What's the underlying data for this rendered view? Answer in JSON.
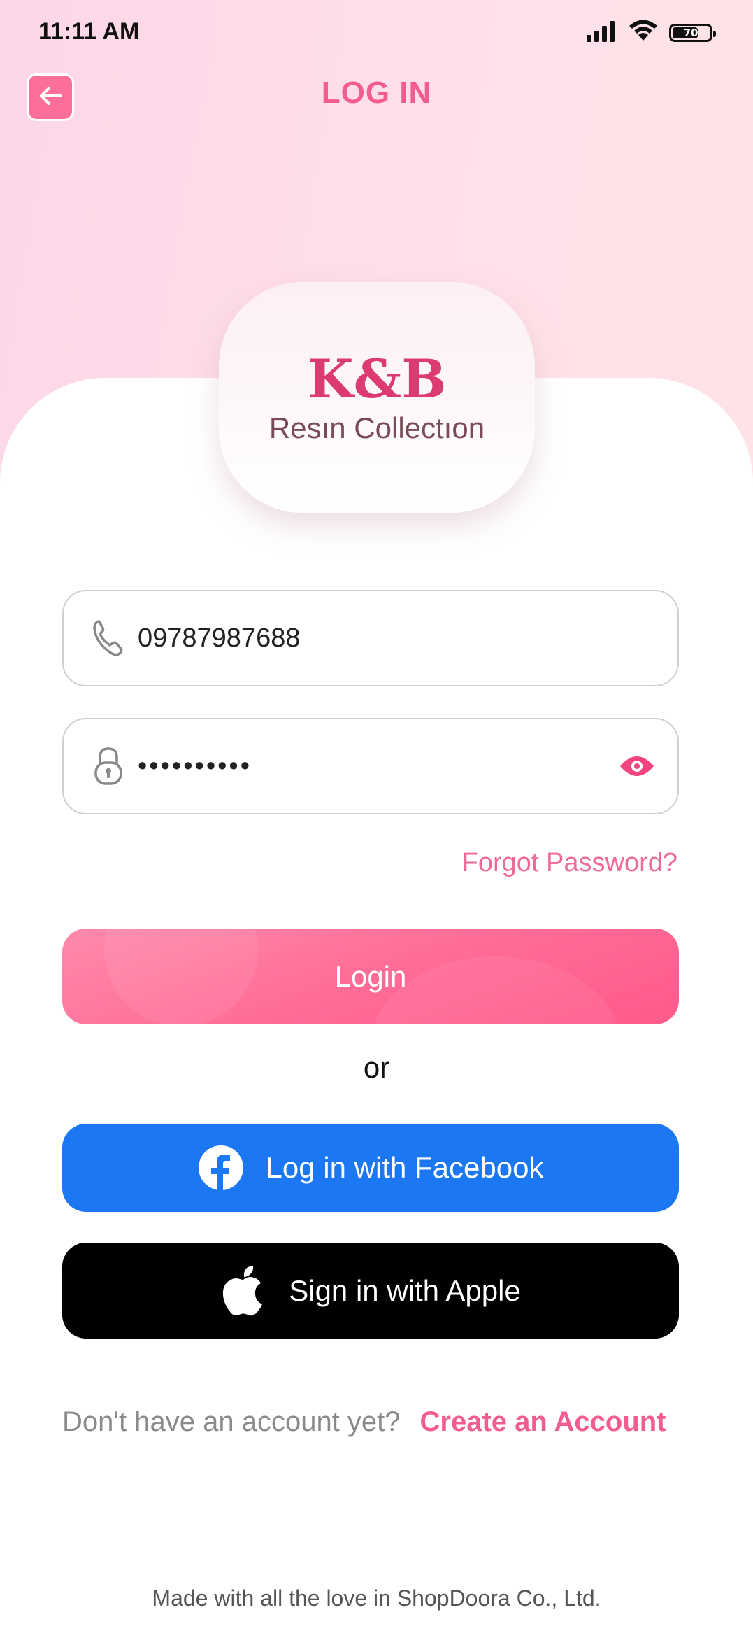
{
  "status_bar": {
    "time": "11:11 AM",
    "battery_level": "70",
    "battery_fraction": 0.7,
    "icons": [
      "signal-icon",
      "wifi-icon",
      "battery-icon"
    ]
  },
  "header": {
    "title": "LOG IN",
    "back_icon": "arrow-left-icon"
  },
  "brand": {
    "logo_mark": "K&B",
    "logo_subtitle": "Resın Collectıon"
  },
  "form": {
    "phone": {
      "icon": "phone-icon",
      "value": "09787987688"
    },
    "password": {
      "icon": "lock-icon",
      "masked_value": "••••••••••",
      "toggle_icon": "eye-icon"
    },
    "forgot_password_label": "Forgot Password?",
    "login_label": "Login",
    "or_label": "or"
  },
  "social": {
    "facebook_label": "Log in with Facebook",
    "facebook_icon": "facebook-icon",
    "apple_label": "Sign in with Apple",
    "apple_icon": "apple-icon"
  },
  "signup": {
    "prompt": "Don't have an account yet?",
    "link_label": "Create an Account"
  },
  "footer": {
    "text": "Made with all the love in ShopDoora Co., Ltd."
  },
  "colors": {
    "accent_pink": "#f25c8f",
    "login_button": "#ff6d97",
    "facebook_blue": "#1b77f2",
    "apple_black": "#000000",
    "background_gradient_start": "#fcd6e8",
    "background_gradient_end": "#ffe3e6"
  }
}
